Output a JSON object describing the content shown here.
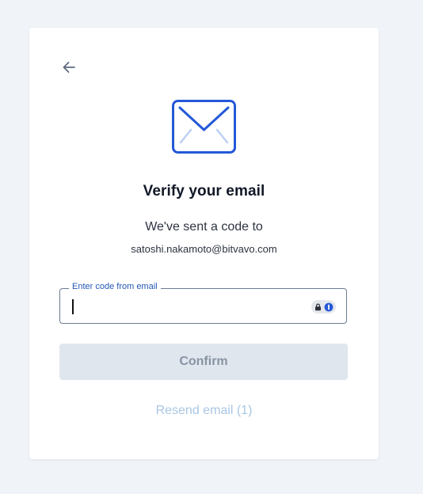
{
  "card": {
    "back_icon": "arrow-left-icon",
    "mail_icon": "envelope-icon",
    "title": "Verify your email",
    "subtitle": "We've sent a code to",
    "email": "satoshi.nakamoto@bitvavo.com"
  },
  "code_field": {
    "label": "Enter code from email",
    "value": "",
    "password_manager_icon": "password-manager-icon"
  },
  "confirm_button": {
    "label": "Confirm",
    "disabled": true
  },
  "resend": {
    "label": "Resend email (1)",
    "disabled": true
  },
  "colors": {
    "background": "#f0f3f7",
    "accent": "#2458b5",
    "disabled_button": "#e0e6ee",
    "disabled_text": "#8793a3",
    "disabled_link": "#a9c6e3"
  }
}
